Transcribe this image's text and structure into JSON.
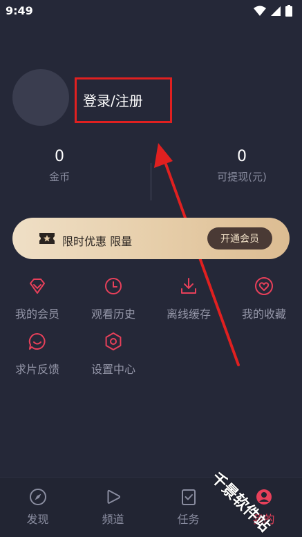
{
  "status_bar": {
    "time": "9:49"
  },
  "profile": {
    "login_label": "登录/注册"
  },
  "stats": [
    {
      "value": "0",
      "label": "金币"
    },
    {
      "value": "0",
      "label": "可提现(元)"
    }
  ],
  "vip": {
    "promo_text": "限时优惠 限量",
    "button_label": "开通会员"
  },
  "menu": [
    {
      "label": "我的会员",
      "icon": "diamond-icon"
    },
    {
      "label": "观看历史",
      "icon": "clock-icon"
    },
    {
      "label": "离线缓存",
      "icon": "download-icon"
    },
    {
      "label": "我的收藏",
      "icon": "heart-icon"
    },
    {
      "label": "求片反馈",
      "icon": "chat-smile-icon"
    },
    {
      "label": "设置中心",
      "icon": "settings-hexagon-icon"
    }
  ],
  "bottom_nav": [
    {
      "label": "发现",
      "icon": "compass-icon",
      "active": false
    },
    {
      "label": "频道",
      "icon": "play-icon",
      "active": false
    },
    {
      "label": "任务",
      "icon": "task-icon",
      "active": false
    },
    {
      "label": "我的",
      "icon": "profile-icon",
      "active": true
    }
  ],
  "watermark": "千景软件站",
  "colors": {
    "accent": "#e8405a",
    "background": "#252838",
    "annotation": "#e02020",
    "vip_gold": "#e6cda8"
  }
}
